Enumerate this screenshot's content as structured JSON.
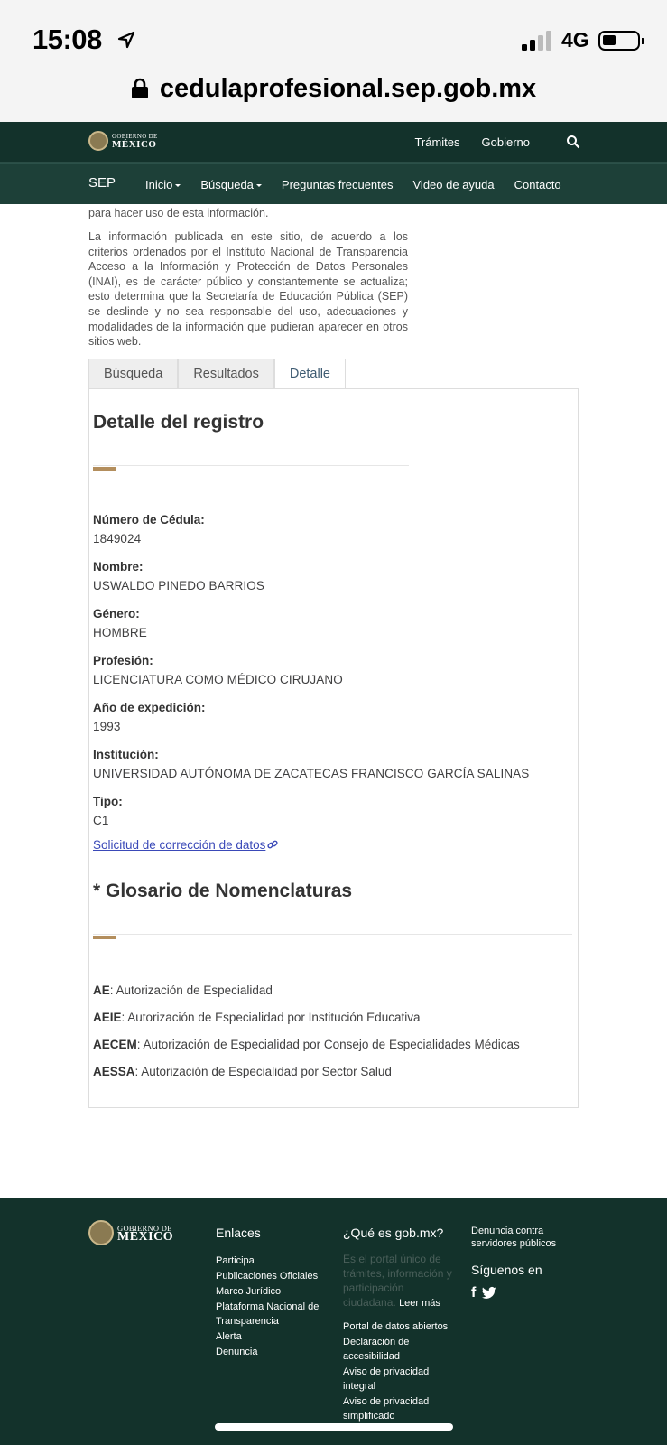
{
  "status_bar": {
    "time": "15:08",
    "network": "4G"
  },
  "browser": {
    "url": "cedulaprofesional.sep.gob.mx"
  },
  "gov_header": {
    "logo_small": "GOBIERNO DE",
    "logo_big": "MÉXICO",
    "links": [
      "Trámites",
      "Gobierno"
    ]
  },
  "nav": {
    "brand": "SEP",
    "items": [
      "Inicio",
      "Búsqueda",
      "Preguntas frecuentes",
      "Video de ayuda",
      "Contacto"
    ]
  },
  "intro": {
    "line1": "para hacer uso de esta información.",
    "paragraph": "La información publicada en este sitio, de acuerdo a los criterios ordenados por el Instituto Nacional de Transparencia Acceso a la Información y Protección de Datos Personales (INAI), es de carácter público y constantemente se actualiza; esto determina que la Secretaría de Educación Pública (SEP) se deslinde y no sea responsable del uso, adecuaciones y modalidades de la información que pudieran aparecer en otros sitios web."
  },
  "tabs": [
    "Búsqueda",
    "Resultados",
    "Detalle"
  ],
  "detail": {
    "title": "Detalle del registro",
    "fields": [
      {
        "label": "Número de Cédula:",
        "value": "1849024"
      },
      {
        "label": "Nombre:",
        "value": "USWALDO PINEDO BARRIOS"
      },
      {
        "label": "Género:",
        "value": "HOMBRE"
      },
      {
        "label": "Profesión:",
        "value": "LICENCIATURA COMO MÉDICO CIRUJANO"
      },
      {
        "label": "Año de expedición:",
        "value": "1993"
      },
      {
        "label": "Institución:",
        "value": "UNIVERSIDAD AUTÓNOMA DE ZACATECAS FRANCISCO GARCÍA SALINAS"
      },
      {
        "label": "Tipo:",
        "value": "C1"
      }
    ],
    "correction_link": "Solicitud de corrección de datos"
  },
  "glossary": {
    "title": "* Glosario de Nomenclaturas",
    "items": [
      {
        "abbr": "AE",
        "text": ": Autorización de Especialidad"
      },
      {
        "abbr": "AEIE",
        "text": ": Autorización de Especialidad por Institución Educativa"
      },
      {
        "abbr": "AECEM",
        "text": ": Autorización de Especialidad por Consejo de Especialidades Médicas"
      },
      {
        "abbr": "AESSA",
        "text": ": Autorización de Especialidad por Sector Salud"
      }
    ]
  },
  "footer": {
    "logo_small": "GOBIERNO DE",
    "logo_big": "MÉXICO",
    "enlaces_title": "Enlaces",
    "enlaces": [
      "Participa",
      "Publicaciones Oficiales",
      "Marco Jurídico",
      "Plataforma Nacional de Transparencia",
      "Alerta",
      "Denuncia"
    ],
    "que_es_title": "¿Qué es gob.mx?",
    "que_es_text": "Es el portal único de trámites, información y participación ciudadana.",
    "leer_mas": "Leer más",
    "que_es_links": [
      "Portal de datos abiertos",
      "Declaración de accesibilidad",
      "Aviso de privacidad integral",
      "Aviso de privacidad simplificado"
    ],
    "denuncia": "Denuncia contra servidores públicos",
    "siguenos": "Síguenos en",
    "social": [
      "f",
      "t"
    ]
  }
}
